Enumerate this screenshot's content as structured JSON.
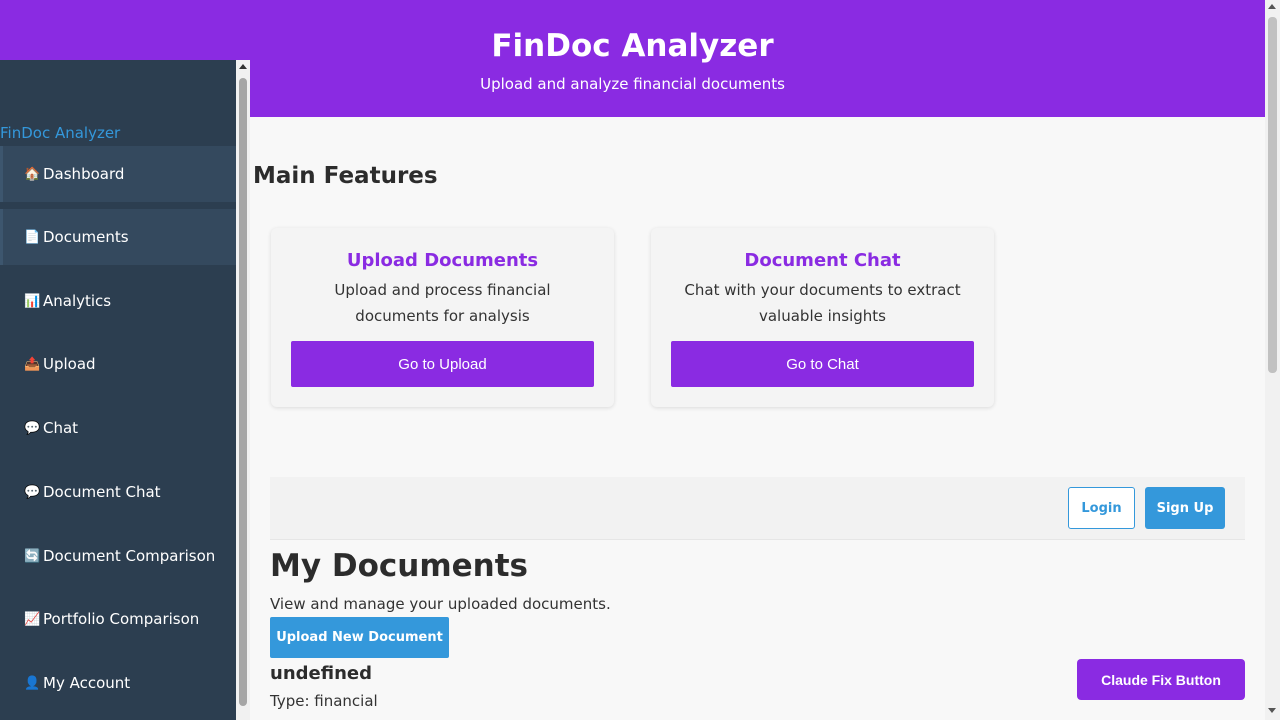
{
  "header": {
    "title": "FinDoc Analyzer",
    "subtitle": "Upload and analyze financial documents"
  },
  "sidebar": {
    "brand": "FinDoc Analyzer",
    "items": [
      {
        "label": "Dashboard",
        "icon": "🏠"
      },
      {
        "label": "Documents",
        "icon": "📄"
      },
      {
        "label": "Analytics",
        "icon": "📊"
      },
      {
        "label": "Upload",
        "icon": "📤"
      },
      {
        "label": "Chat",
        "icon": "💬"
      },
      {
        "label": "Document Chat",
        "icon": "💬"
      },
      {
        "label": "Document Comparison",
        "icon": "🔄"
      },
      {
        "label": "Portfolio Comparison",
        "icon": "📈"
      },
      {
        "label": "My Account",
        "icon": "👤"
      }
    ]
  },
  "main": {
    "heading": "Main Features",
    "cards": [
      {
        "title": "Upload Documents",
        "description": "Upload and process financial documents for analysis",
        "button": "Go to Upload"
      },
      {
        "title": "Document Chat",
        "description": "Chat with your documents to extract valuable insights",
        "button": "Go to Chat"
      }
    ]
  },
  "auth": {
    "login": "Login",
    "signup": "Sign Up"
  },
  "documents": {
    "title": "My Documents",
    "description": "View and manage your uploaded documents.",
    "upload_button": "Upload New Document",
    "items": [
      {
        "name": "undefined",
        "type": "Type: financial"
      }
    ]
  },
  "claude_fix_button": "Claude Fix Button"
}
